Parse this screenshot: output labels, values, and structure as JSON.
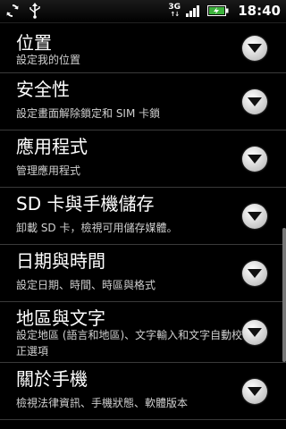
{
  "status_bar": {
    "network": "3G",
    "time": "18:40",
    "icons": [
      "sync-icon",
      "usb-icon",
      "network-3g-icon",
      "signal-icon",
      "battery-charging-icon"
    ]
  },
  "settings": [
    {
      "title": "位置",
      "summary": "設定我的位置"
    },
    {
      "title": "安全性",
      "summary": "設定畫面解除鎖定和 SIM 卡鎖"
    },
    {
      "title": "應用程式",
      "summary": "管理應用程式"
    },
    {
      "title": "SD 卡與手機儲存",
      "summary": "卸載 SD 卡，檢視可用儲存媒體。"
    },
    {
      "title": "日期與時間",
      "summary": "設定日期、時間、時區與格式"
    },
    {
      "title": "地區與文字",
      "summary": "設定地區 (語言和地區)、文字輸入和文字自動校正選項"
    },
    {
      "title": "關於手機",
      "summary": "檢視法律資訊、手機狀態、軟體版本"
    }
  ],
  "colors": {
    "background": "#000000",
    "divider": "#3a3a3a",
    "summary": "#d0d0d0"
  }
}
